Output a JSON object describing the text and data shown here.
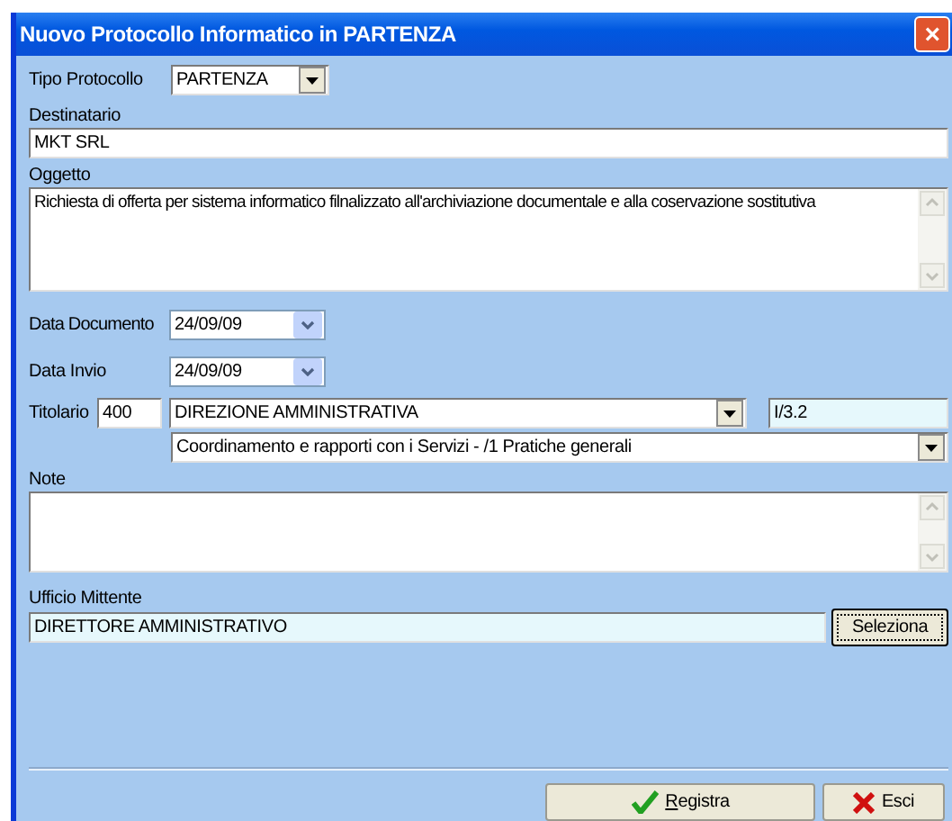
{
  "window": {
    "title": "Nuovo Protocollo Informatico in PARTENZA",
    "close": "×"
  },
  "tipo_protocollo": {
    "label": "Tipo Protocollo",
    "value": "PARTENZA"
  },
  "destinatario": {
    "label": "Destinatario",
    "value": "MKT SRL"
  },
  "oggetto": {
    "label": "Oggetto",
    "value": "Richiesta di offerta per sistema informatico filnalizzato all'archiviazione documentale e alla coservazione sostitutiva"
  },
  "data_documento": {
    "label": "Data Documento",
    "value": "24/09/09"
  },
  "data_invio": {
    "label": "Data Invio",
    "value": "24/09/09"
  },
  "titolario": {
    "label": "Titolario",
    "code": "400",
    "category": "DIREZIONE AMMINISTRATIVA",
    "index": "I/3.2",
    "subcategory": "Coordinamento e rapporti con i Servizi - /1 Pratiche generali"
  },
  "note": {
    "label": "Note"
  },
  "ufficio_mittente": {
    "label": "Ufficio Mittente",
    "value": "DIRETTORE AMMINISTRATIVO",
    "button": "Seleziona"
  },
  "buttons": [
    {
      "kind": "ok",
      "label": "Registra"
    },
    {
      "kind": "cancel",
      "label": "Esci"
    }
  ]
}
